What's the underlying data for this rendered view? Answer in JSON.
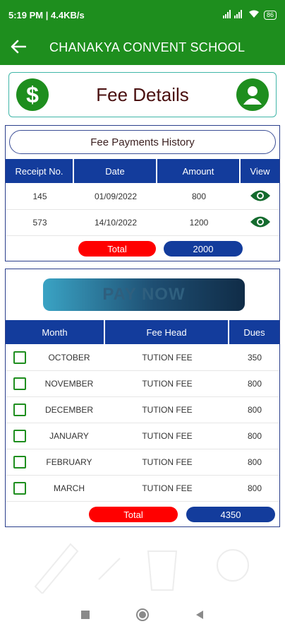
{
  "status_bar": {
    "time_speed": "5:19 PM | 4.4KB/s",
    "battery": "86"
  },
  "app_bar": {
    "title": "CHANAKYA CONVENT SCHOOL",
    "back_icon": "arrow-left-icon"
  },
  "header": {
    "title": "Fee Details",
    "left_icon": "dollar-icon",
    "right_icon": "user-icon"
  },
  "history": {
    "title": "Fee Payments History",
    "columns": [
      "Receipt No.",
      "Date",
      "Amount",
      "View"
    ],
    "rows": [
      {
        "receipt": "145",
        "date": "01/09/2022",
        "amount": "800"
      },
      {
        "receipt": "573",
        "date": "14/10/2022",
        "amount": "1200"
      }
    ],
    "total_label": "Total",
    "total_value": "2000"
  },
  "dues": {
    "pay_label": "PAY NOW",
    "columns": [
      "Month",
      "Fee Head",
      "Dues"
    ],
    "rows": [
      {
        "month": "OCTOBER",
        "head": "TUTION FEE",
        "due": "350"
      },
      {
        "month": "NOVEMBER",
        "head": "TUTION FEE",
        "due": "800"
      },
      {
        "month": "DECEMBER",
        "head": "TUTION FEE",
        "due": "800"
      },
      {
        "month": "JANUARY",
        "head": "TUTION FEE",
        "due": "800"
      },
      {
        "month": "FEBRUARY",
        "head": "TUTION FEE",
        "due": "800"
      },
      {
        "month": "MARCH",
        "head": "TUTION FEE",
        "due": "800"
      }
    ],
    "total_label": "Total",
    "total_value": "4350"
  },
  "colors": {
    "primary_green": "#1e8e1e",
    "table_header_blue": "#133c9c",
    "total_red": "#ff0000"
  }
}
